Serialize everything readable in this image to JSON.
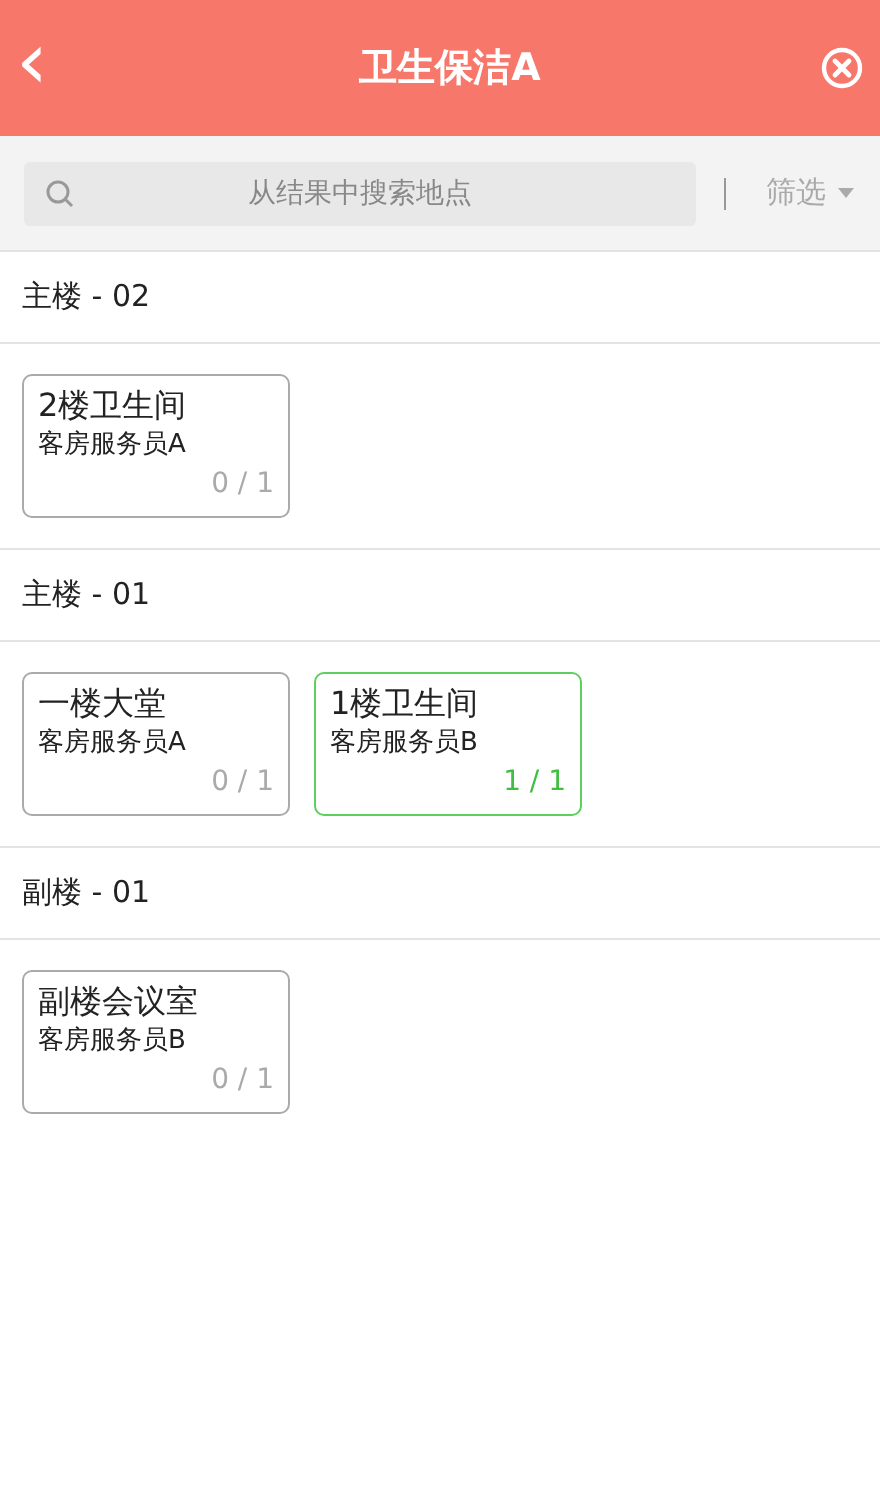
{
  "header": {
    "back": "‹",
    "title": "卫生保洁A"
  },
  "search": {
    "placeholder": "从结果中搜索地点",
    "filter": "筛选"
  },
  "groups": [
    {
      "name": "主楼 - 02",
      "places": [
        {
          "name": "2楼卫生间",
          "staff": "客房服务员A",
          "count": "0 / 1",
          "done": false
        }
      ]
    },
    {
      "name": "主楼 - 01",
      "places": [
        {
          "name": "一楼大堂",
          "staff": "客房服务员A",
          "count": "0 / 1",
          "done": false
        },
        {
          "name": "1楼卫生间",
          "staff": "客房服务员B",
          "count": "1 / 1",
          "done": true
        }
      ]
    },
    {
      "name": "副楼 - 01",
      "places": [
        {
          "name": "副楼会议室",
          "staff": "客房服务员B",
          "count": "0 / 1",
          "done": false
        }
      ]
    }
  ]
}
